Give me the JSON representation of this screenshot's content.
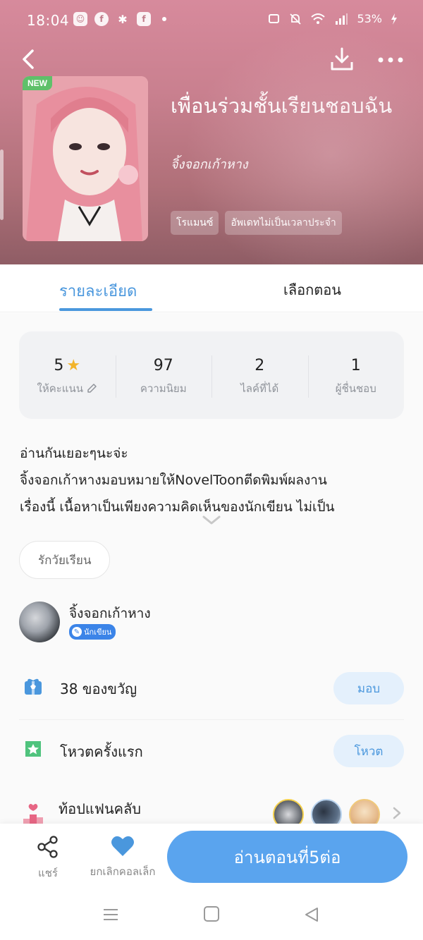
{
  "status": {
    "time": "18:04",
    "battery": "53%",
    "icons_left": [
      "notification-app-icon",
      "facebook-icon",
      "pinwheel-icon",
      "facebook-page-icon"
    ],
    "icons_right": [
      "cast-icon",
      "mute-icon",
      "wifi-icon",
      "signal-icon",
      "battery-icon"
    ]
  },
  "book": {
    "badge": "NEW",
    "title": "เพื่อนร่วมชั้นเรียนชอบฉัน",
    "author": "จิ้งจอกเก้าหาง",
    "tags": [
      "โรแมนซ์",
      "อัพเดทไม่เป็นเวลาประจำ"
    ]
  },
  "tabs": {
    "details": "รายละเอียด",
    "episodes": "เลือกตอน"
  },
  "stats": [
    {
      "value": "5",
      "label": "ให้คะแนน",
      "icon": "star-icon",
      "extra_icon": "pencil-icon"
    },
    {
      "value": "97",
      "label": "ความนิยม"
    },
    {
      "value": "2",
      "label": "ไลค์ที่ได้"
    },
    {
      "value": "1",
      "label": "ผู้ชื่นชอบ"
    }
  ],
  "description": {
    "line1": "อ่านกันเยอะๆนะจ่ะ",
    "line2": "จิ้งจอกเก้าหางมอบหมายให้NovelToonตีดพิมพ์ผลงาน",
    "line3": "เรื่องนี้ เนื้อหาเป็นเพียงความคิดเห็นของนักเขียน ไม่เป็น"
  },
  "genre_chip": "รักวัยเรียน",
  "writer": {
    "name": "จิ้งจอกเก้าหาง",
    "badge": "นักเขียน"
  },
  "gifts": {
    "text": "38 ของขวัญ",
    "button": "มอบ"
  },
  "vote": {
    "text": "โหวตครั้งแรก",
    "button": "โหวต"
  },
  "fanclub": {
    "text": "ท้อปแฟนคลับ"
  },
  "bottom": {
    "share": "แชร์",
    "unfavorite": "ยกเลิกคอลเล็ก",
    "read": "อ่านตอนที่5ต่อ"
  },
  "colors": {
    "accent": "#4a97dd",
    "read_button": "#5aa4ee",
    "new_badge": "#5fc06a",
    "star": "#f2b42a"
  }
}
